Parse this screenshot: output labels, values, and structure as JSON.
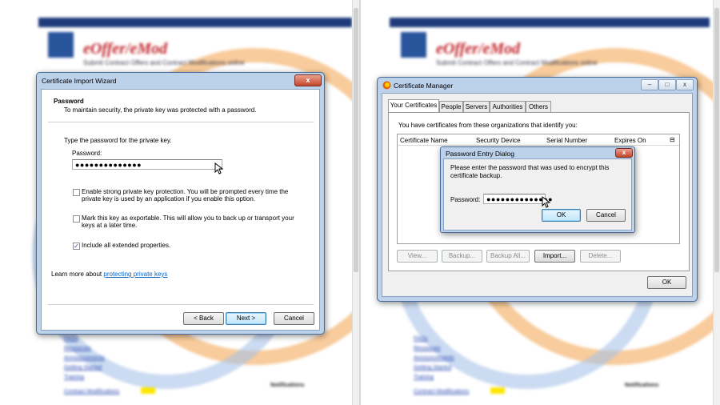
{
  "import_wizard": {
    "title": "Certificate Import Wizard",
    "close_glyph": "x",
    "header_title": "Password",
    "header_desc": "To maintain security, the private key was protected with a password.",
    "prompt": "Type the password for the private key.",
    "password_label": "Password:",
    "password_value": "●●●●●●●●●●●●●●",
    "option1_text": "Enable strong private key protection. You will be prompted every time the private key is used by an application if you enable this option.",
    "option1_line1": "Enable strong private key protection. You will be prompted every time the",
    "option1_line2": "private key is used by an application if you enable this option.",
    "option1_checked": false,
    "option2_line1": "Mark this key as exportable. This will allow you to back up or transport your",
    "option2_line2": "keys at a later time.",
    "option2_checked": false,
    "option3_text": "Include all extended properties.",
    "option3_checked": true,
    "learn_more_prefix": "Learn more about ",
    "learn_more_link": "protecting private keys",
    "back_label": "< Back",
    "next_label": "Next >",
    "cancel_label": "Cancel"
  },
  "cert_manager": {
    "title": "Certificate Manager",
    "tabs": [
      "Your Certificates",
      "People",
      "Servers",
      "Authorities",
      "Others"
    ],
    "active_tab": "Your Certificates",
    "intro": "You have certificates from these organizations that identify you:",
    "columns": [
      "Certificate Name",
      "Security Device",
      "Serial Number",
      "Expires On"
    ],
    "buttons": {
      "view": "View...",
      "backup": "Backup...",
      "backup_all": "Backup All...",
      "import": "Import...",
      "delete": "Delete...",
      "ok": "OK"
    }
  },
  "password_dialog": {
    "title": "Password Entry Dialog",
    "message_line1": "Please enter the password that was used to encrypt this",
    "message_line2": "certificate backup.",
    "password_label": "Password:",
    "password_value": "●●●●●●●●●●●●●●",
    "ok_label": "OK",
    "cancel_label": "Cancel"
  },
  "background_page": {
    "brand": "eOffer/eMod",
    "tagline": "Submit Contract Offers and Contract Modifications online",
    "left_links": [
      "FAQs",
      "Resources",
      "Announcements",
      "Getting Started",
      "Training",
      "Contract Modifications"
    ],
    "right_head": "Notifications",
    "colors": {
      "topbar": "#1d3a7a",
      "brand": "#c1272d",
      "accent": "#f2a24a"
    }
  }
}
